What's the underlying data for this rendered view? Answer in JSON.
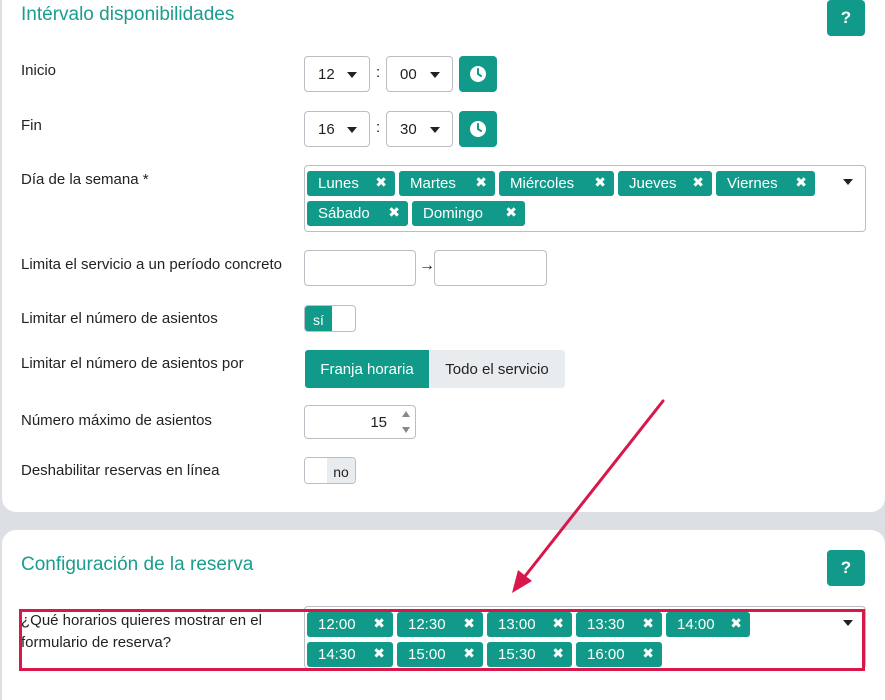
{
  "section1": {
    "title": "Intérvalo disponibilidades",
    "help_label": "?",
    "inicio": {
      "label": "Inicio",
      "hour": "12",
      "minute": "00",
      "separator": ":"
    },
    "fin": {
      "label": "Fin",
      "hour": "16",
      "minute": "30",
      "separator": ":"
    },
    "dias": {
      "label": "Día de la semana *",
      "tags": [
        "Lunes",
        "Martes",
        "Miércoles",
        "Jueves",
        "Viernes",
        "Sábado",
        "Domingo"
      ]
    },
    "periodo": {
      "label": "Limita el servicio a un período concreto",
      "arrow": "→"
    },
    "limitar_asientos": {
      "label": "Limitar el número de asientos",
      "toggle_text": "sí"
    },
    "limitar_por": {
      "label": "Limitar el número de asientos por",
      "options": [
        "Franja horaria",
        "Todo el servicio"
      ],
      "selected": "Franja horaria"
    },
    "max_asientos": {
      "label": "Número máximo de asientos",
      "value": "15"
    },
    "deshabilitar": {
      "label": "Deshabilitar reservas en línea",
      "toggle_text": "no"
    }
  },
  "section2": {
    "title": "Configuración de la reserva",
    "help_label": "?",
    "horarios": {
      "label": "¿Qué horarios quieres mostrar en el formulario de reserva?",
      "tags": [
        "12:00",
        "12:30",
        "13:00",
        "13:30",
        "14:00",
        "14:30",
        "15:00",
        "15:30",
        "16:00"
      ]
    }
  },
  "colors": {
    "accent": "#119a89",
    "title": "#1a9d8c",
    "annotation": "#d8174b",
    "background": "#dcdfe3"
  },
  "icons": {
    "clock": "clock-icon",
    "remove": "✖"
  }
}
